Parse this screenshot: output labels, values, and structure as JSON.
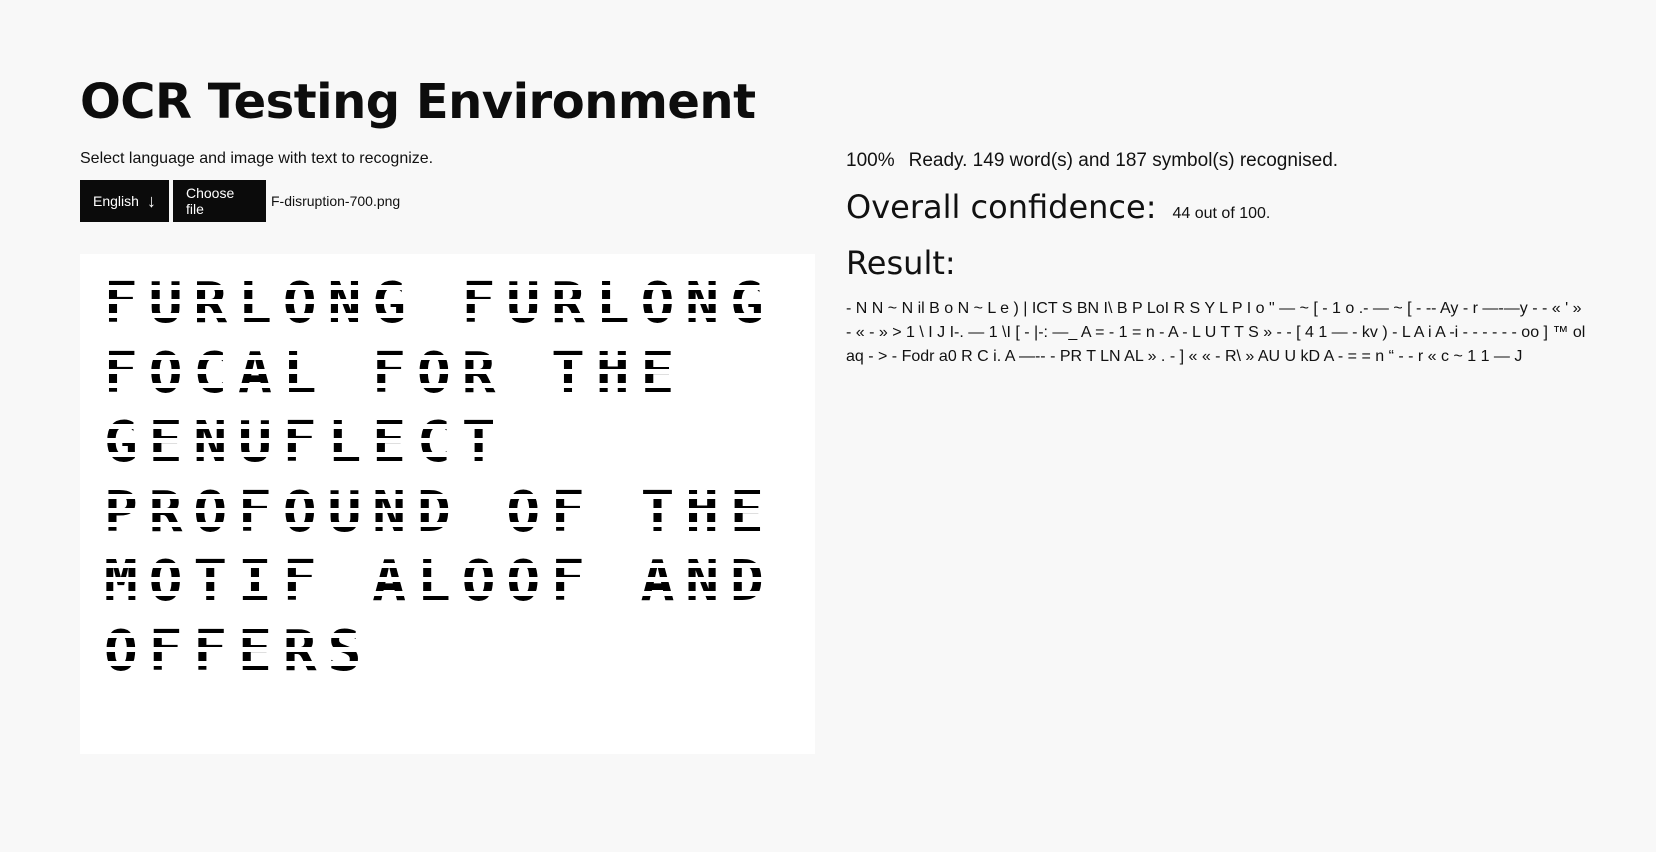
{
  "page": {
    "title": "OCR Testing Environment",
    "instructions": "Select language and image with text to recognize."
  },
  "controls": {
    "language_selected": "English",
    "language_arrow_icon": "arrow-down-icon",
    "choose_file_label": "Choose file",
    "file_name": "F-disruption-700.png"
  },
  "image": {
    "lines": [
      "FURLONG FURLONG",
      "FOCAL FOR THE",
      "GENUFLECT",
      "PROFOUND OF THE",
      "MOTIF ALOOF AND",
      "OFFERS"
    ]
  },
  "status": {
    "progress": "100%",
    "message": "Ready. 149 word(s) and 187 symbol(s) recognised."
  },
  "confidence": {
    "label": "Overall confidence:",
    "value": "44 out of 100."
  },
  "result": {
    "label": "Result:",
    "text": "- N N ~ N il B o N ~ L e ) | ICT S BN I\\ B P LoI R S Y L P I o \" — ~ [ - 1 o .- — ~ [ - -- Ay - r —-—y - - « ' » - « - » > 1 \\ I J I-. — 1 \\I [ - |-: —_ A = - 1 = n - A - L U T T S » - - [ 4 1 — - kv ) - L A i A -i - - - - - - oo ] ™ ol aq - > - Fodr a0 R C i. A —-- - PR T LN AL » . - ] « « - R\\ » AU U kD A - = = n “ - - r « c ~ 1 1 — J"
  },
  "colors": {
    "background": "#f8f8f8",
    "button_background": "#0b0b0b",
    "button_text": "#ffffff",
    "panel": "#ffffff"
  }
}
